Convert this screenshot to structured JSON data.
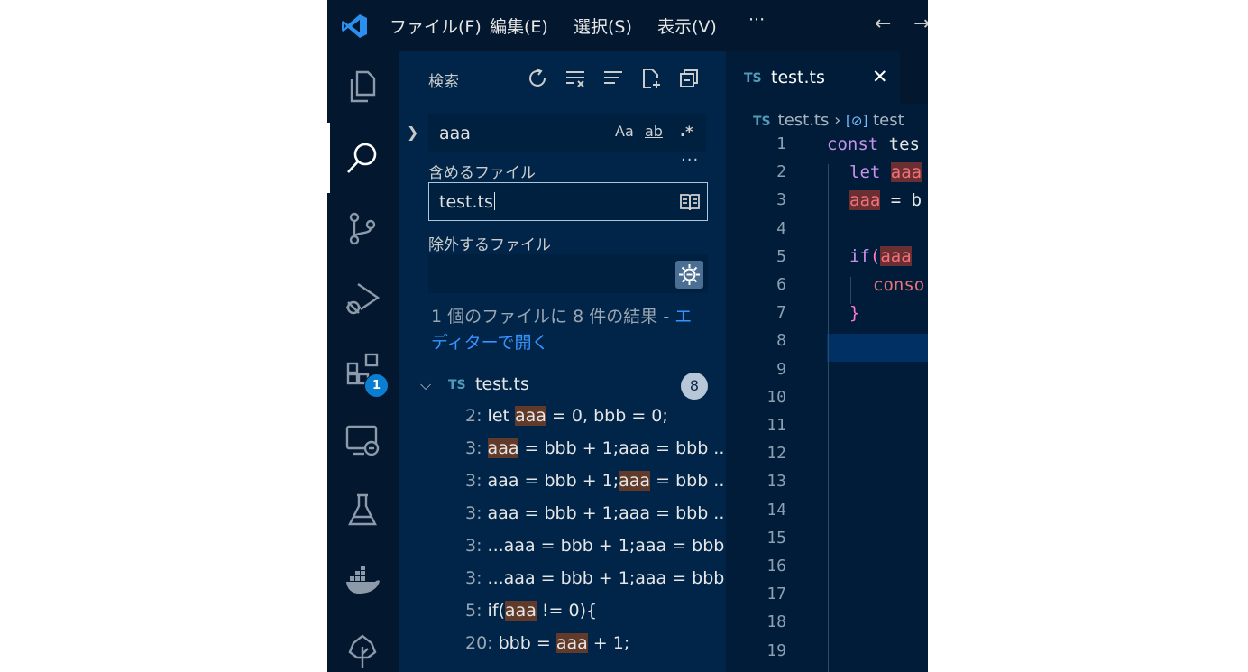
{
  "titlebar": {
    "menus": [
      "ファイル(F)",
      "編集(E)",
      "選択(S)",
      "表示(V)",
      "···"
    ]
  },
  "activity": {
    "items": [
      "explorer-icon",
      "search-icon",
      "source-control-icon",
      "run-debug-icon",
      "extensions-icon",
      "remote-explorer-icon",
      "testing-icon",
      "docker-icon",
      "tree-icon"
    ],
    "extensions_badge": "1"
  },
  "sidebar": {
    "title": "検索",
    "search_value": "aaa",
    "options": [
      "Aa",
      "ab",
      ".*"
    ],
    "more": "···",
    "include_label": "含めるファイル",
    "include_value": "test.ts",
    "exclude_label": "除外するファイル",
    "summary_prefix": "1 個のファイルに 8 件の結果 - ",
    "summary_link": "エディターで開く",
    "file": {
      "lang": "TS",
      "name": "test.ts",
      "count": "8"
    },
    "matches": [
      {
        "line": "2:",
        "pre": " let ",
        "hl": "aaa",
        "post": " = 0, bbb = 0;"
      },
      {
        "line": "3:",
        "pre": " ",
        "hl": "aaa",
        "post": " = bbb + 1;aaa = bbb ..."
      },
      {
        "line": "3:",
        "pre": " aaa = bbb + 1;",
        "hl": "aaa",
        "post": " = bbb ..."
      },
      {
        "line": "3:",
        "pre": " aaa = bbb + 1;aaa = bbb ...",
        "hl": "",
        "post": ""
      },
      {
        "line": "3:",
        "pre": " ...aaa = bbb + 1;aaa = bbb...",
        "hl": "",
        "post": ""
      },
      {
        "line": "3:",
        "pre": " ...aaa = bbb + 1;aaa = bbb...",
        "hl": "",
        "post": ""
      },
      {
        "line": "5:",
        "pre": " if(",
        "hl": "aaa",
        "post": " != 0){"
      },
      {
        "line": "20:",
        "pre": " bbb = ",
        "hl": "aaa",
        "post": " + 1;"
      }
    ]
  },
  "editor": {
    "tab": {
      "lang": "TS",
      "label": "test.ts",
      "close": "✕"
    },
    "breadcrumb": {
      "lang": "TS",
      "file": "test.ts",
      "sep": "›",
      "symbol": "test"
    },
    "line_numbers": [
      "1",
      "2",
      "3",
      "4",
      "5",
      "6",
      "7",
      "8",
      "9",
      "10",
      "11",
      "12",
      "13",
      "14",
      "15",
      "16",
      "17",
      "18",
      "19"
    ],
    "code": {
      "l1_kw": "const",
      "l1_id": "tes",
      "l2_kw": "let",
      "l2_v": "aaa",
      "l3_v": "aaa",
      "l3_rest": " = b",
      "l5_kw": "if",
      "l5_p": "(",
      "l5_v": "aaa",
      "l6_fn": "conso",
      "l7_br": "}"
    }
  },
  "colors": {
    "activity_bg": "#03172e",
    "sidebar_bg": "#002548",
    "editor_bg": "#001c38",
    "match_highlight": "#613a2a",
    "accent_link": "#3794ff"
  }
}
